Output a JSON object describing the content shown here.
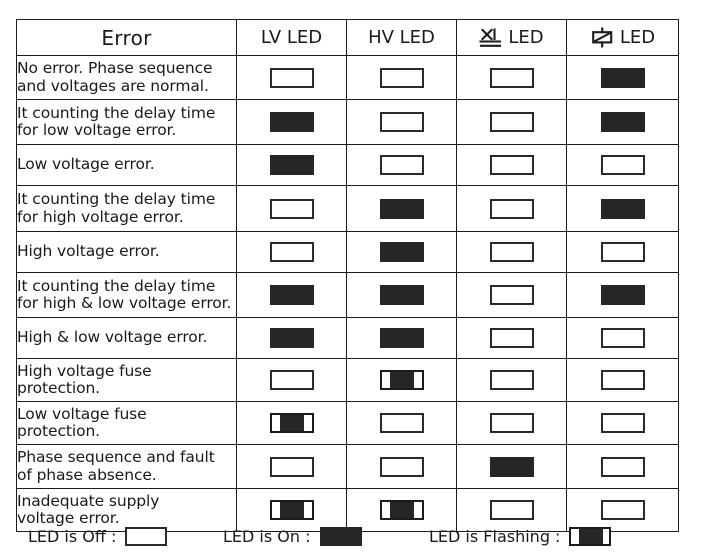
{
  "table": {
    "columns": [
      {
        "key": "error",
        "label": "Error",
        "icon": null
      },
      {
        "key": "lv",
        "label": "LV LED",
        "icon": null
      },
      {
        "key": "hv",
        "label": "HV LED",
        "icon": null
      },
      {
        "key": "phase",
        "label": "LED",
        "icon": "phase-fault-icon"
      },
      {
        "key": "supply",
        "label": "LED",
        "icon": "supply-fault-icon"
      }
    ],
    "rows": [
      {
        "error_line1": "No error. Phase sequence",
        "error_line2": "and voltages are normal.",
        "lv": "off",
        "hv": "off",
        "phase": "off",
        "supply": "on"
      },
      {
        "error_line1": "It counting the delay time",
        "error_line2": "for low voltage error.",
        "lv": "on",
        "hv": "off",
        "phase": "off",
        "supply": "on"
      },
      {
        "error_line1": "Low voltage error.",
        "error_line2": "",
        "lv": "on",
        "hv": "off",
        "phase": "off",
        "supply": "off"
      },
      {
        "error_line1": "It counting the delay time",
        "error_line2": "for high voltage error.",
        "lv": "off",
        "hv": "on",
        "phase": "off",
        "supply": "on"
      },
      {
        "error_line1": "High voltage error.",
        "error_line2": "",
        "lv": "off",
        "hv": "on",
        "phase": "off",
        "supply": "off"
      },
      {
        "error_line1": "It counting the delay time",
        "error_line2": "for high & low voltage error.",
        "lv": "on",
        "hv": "on",
        "phase": "off",
        "supply": "on"
      },
      {
        "error_line1": "High & low voltage error.",
        "error_line2": "",
        "lv": "on",
        "hv": "on",
        "phase": "off",
        "supply": "off"
      },
      {
        "error_line1": "High voltage fuse",
        "error_line2": "protection.",
        "lv": "off",
        "hv": "flash",
        "phase": "off",
        "supply": "off"
      },
      {
        "error_line1": "Low voltage fuse",
        "error_line2": "protection.",
        "lv": "flash",
        "hv": "off",
        "phase": "off",
        "supply": "off"
      },
      {
        "error_line1": "Phase sequence and fault",
        "error_line2": "of phase absence.",
        "lv": "off",
        "hv": "off",
        "phase": "on",
        "supply": "off"
      },
      {
        "error_line1": "Inadequate supply",
        "error_line2": "voltage error.",
        "lv": "flash",
        "hv": "flash",
        "phase": "off",
        "supply": "off"
      }
    ]
  },
  "legend": {
    "off_label": "LED is Off :",
    "on_label": "LED is On :",
    "flashing_label": "LED is Flashing :"
  },
  "colors": {
    "led_on": "#262626",
    "led_off_fill": "#ffffff",
    "border": "#1c1c1c",
    "text": "#1a1a1a"
  }
}
